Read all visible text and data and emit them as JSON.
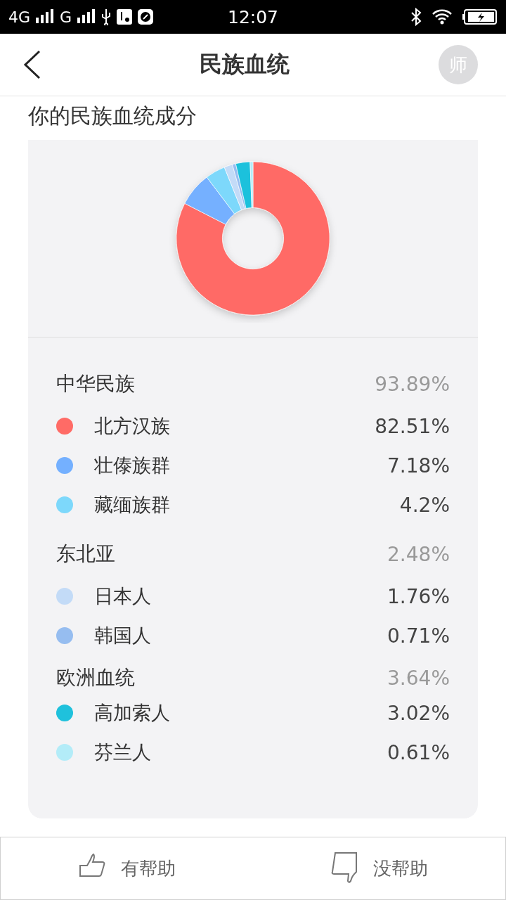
{
  "status_bar": {
    "network_1": "4G",
    "network_2": "G",
    "time": "12:07"
  },
  "header": {
    "title": "民族血统",
    "avatar": "师"
  },
  "section_title": "你的民族血统成分",
  "groups": [
    {
      "name": "中华民族",
      "percent": "93.89%",
      "items": [
        {
          "name": "北方汉族",
          "percent": "82.51%",
          "color": "#ff6b66"
        },
        {
          "name": "壮傣族群",
          "percent": "7.18%",
          "color": "#74b0ff"
        },
        {
          "name": "藏缅族群",
          "percent": "4.2%",
          "color": "#7dd8fb"
        }
      ]
    },
    {
      "name": "东北亚",
      "percent": "2.48%",
      "items": [
        {
          "name": "日本人",
          "percent": "1.76%",
          "color": "#c3dbf7"
        },
        {
          "name": "韩国人",
          "percent": "0.71%",
          "color": "#96bdf0"
        }
      ]
    },
    {
      "name": "欧洲血统",
      "percent": "3.64%",
      "items": [
        {
          "name": "高加索人",
          "percent": "3.02%",
          "color": "#1fc1dc"
        },
        {
          "name": "芬兰人",
          "percent": "0.61%",
          "color": "#b3ecf8"
        }
      ]
    }
  ],
  "footer": {
    "helpful": "有帮助",
    "not_helpful": "没帮助"
  }
}
